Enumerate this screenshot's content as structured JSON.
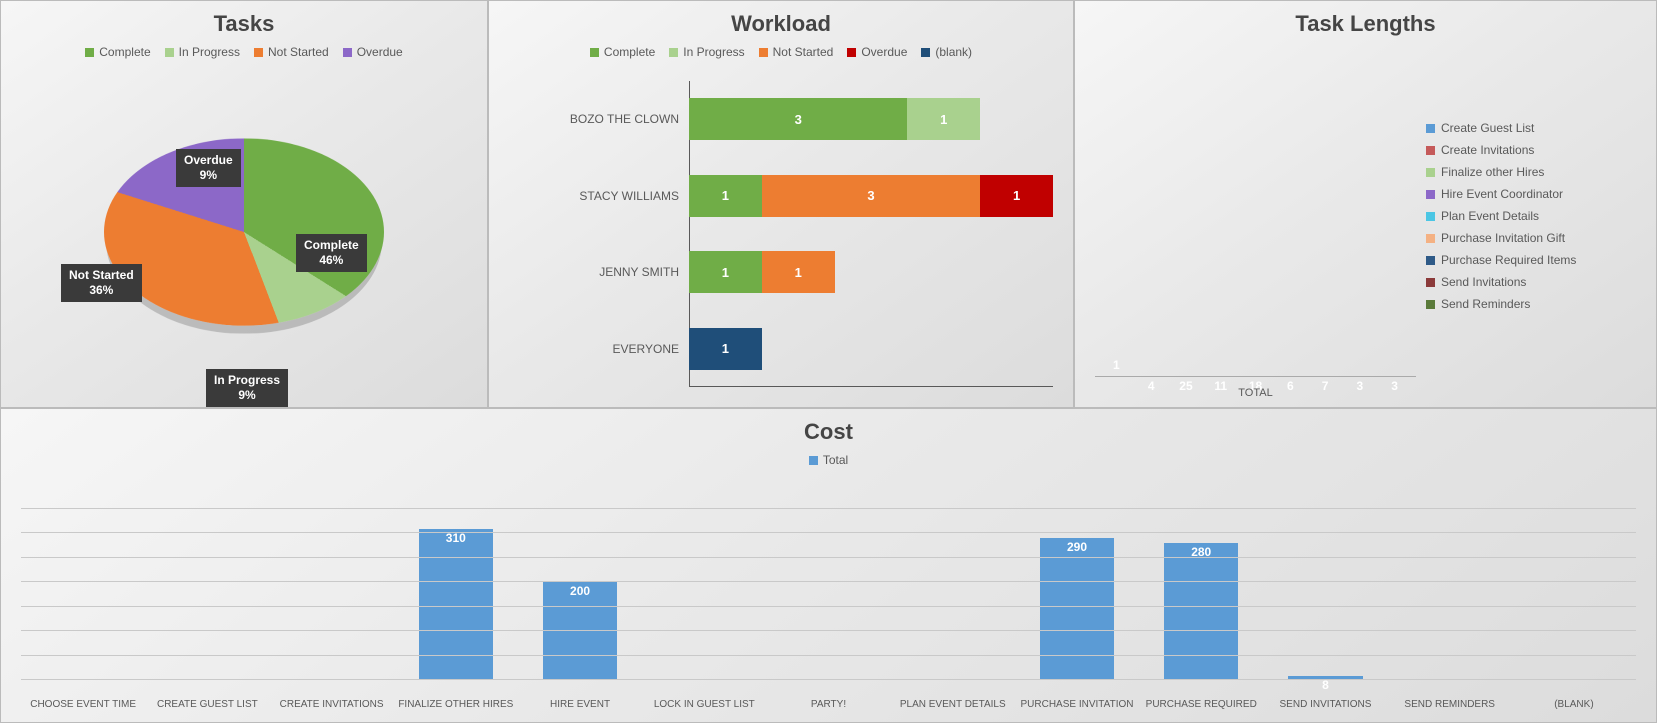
{
  "colors": {
    "complete": "#70ad47",
    "inprogress": "#a9d18e",
    "notstarted": "#ed7d31",
    "overdue": "#8c68c8",
    "overdue_red": "#c00000",
    "blank": "#1f4e79",
    "cost": "#5b9bd5"
  },
  "chart_data": [
    {
      "id": "tasks",
      "type": "pie",
      "title": "Tasks",
      "legend": [
        "Complete",
        "In Progress",
        "Not Started",
        "Overdue"
      ],
      "legend_colors": [
        "#70ad47",
        "#a9d18e",
        "#ed7d31",
        "#8c68c8"
      ],
      "slices": [
        {
          "label": "Complete",
          "pct": 46,
          "color": "#70ad47"
        },
        {
          "label": "In Progress",
          "pct": 9,
          "color": "#a9d18e"
        },
        {
          "label": "Not Started",
          "pct": 36,
          "color": "#ed7d31"
        },
        {
          "label": "Overdue",
          "pct": 9,
          "color": "#8c68c8"
        }
      ]
    },
    {
      "id": "workload",
      "type": "bar-stacked-horizontal",
      "title": "Workload",
      "legend": [
        "Complete",
        "In Progress",
        "Not Started",
        "Overdue",
        "(blank)"
      ],
      "legend_colors": [
        "#70ad47",
        "#a9d18e",
        "#ed7d31",
        "#c00000",
        "#1f4e79"
      ],
      "categories": [
        "BOZO THE CLOWN",
        "STACY WILLIAMS",
        "JENNY SMITH",
        "EVERYONE"
      ],
      "xmax": 5,
      "series": [
        {
          "name": "Complete",
          "color": "#70ad47",
          "values": [
            3,
            1,
            1,
            0
          ]
        },
        {
          "name": "In Progress",
          "color": "#a9d18e",
          "values": [
            1,
            0,
            0,
            0
          ]
        },
        {
          "name": "Not Started",
          "color": "#ed7d31",
          "values": [
            0,
            3,
            1,
            0
          ]
        },
        {
          "name": "Overdue",
          "color": "#c00000",
          "values": [
            0,
            1,
            0,
            0
          ]
        },
        {
          "name": "(blank)",
          "color": "#1f4e79",
          "values": [
            0,
            0,
            0,
            1
          ]
        }
      ]
    },
    {
      "id": "tasklengths",
      "type": "bar",
      "title": "Task Lengths",
      "xlabel": "TOTAL",
      "ymax": 27,
      "series": [
        {
          "name": "Create Guest List",
          "value": 1,
          "color": "#5b9bd5"
        },
        {
          "name": "Create Invitations",
          "value": 4,
          "color": "#c55a5a"
        },
        {
          "name": "Finalize other Hires",
          "value": 25,
          "color": "#a9d18e"
        },
        {
          "name": "Hire Event Coordinator",
          "value": 11,
          "color": "#8c68c8"
        },
        {
          "name": "Plan Event Details",
          "value": 18,
          "color": "#4bc6e4"
        },
        {
          "name": "Purchase Invitation Gift",
          "value": 6,
          "color": "#f4b183"
        },
        {
          "name": "Purchase Required Items",
          "value": 7,
          "color": "#2e5a87"
        },
        {
          "name": "Send Invitations",
          "value": 3,
          "color": "#8b3a3a"
        },
        {
          "name": "Send Reminders",
          "value": 3,
          "color": "#5a7a3a"
        }
      ]
    },
    {
      "id": "cost",
      "type": "bar",
      "title": "Cost",
      "legend": [
        "Total"
      ],
      "legend_colors": [
        "#5b9bd5"
      ],
      "ymax": 350,
      "gridlines": [
        0,
        50,
        100,
        150,
        200,
        250,
        300,
        350
      ],
      "categories": [
        "CHOOSE EVENT TIME",
        "CREATE GUEST LIST",
        "CREATE INVITATIONS",
        "FINALIZE OTHER HIRES",
        "HIRE EVENT",
        "LOCK IN GUEST LIST",
        "PARTY!",
        "PLAN EVENT DETAILS",
        "PURCHASE INVITATION",
        "PURCHASE REQUIRED",
        "SEND INVITATIONS",
        "SEND REMINDERS",
        "(BLANK)"
      ],
      "values": [
        0,
        0,
        0,
        310,
        200,
        0,
        0,
        0,
        290,
        280,
        8,
        0,
        0
      ]
    }
  ]
}
